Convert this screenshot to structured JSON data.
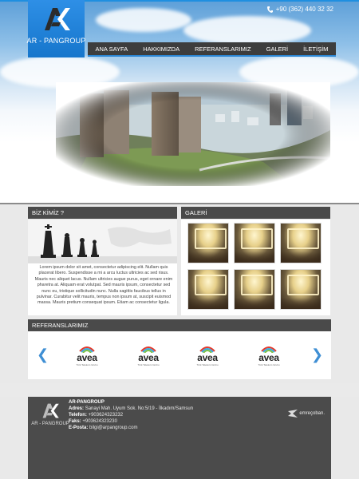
{
  "header": {
    "logo_text": "AR - PANGROUP",
    "phone": "+90 (362) 440 32 32",
    "nav": [
      {
        "label": "ANA SAYFA"
      },
      {
        "label": "HAKKIMIZDA"
      },
      {
        "label": "REFERANSLARIMIZ"
      },
      {
        "label": "GALERİ"
      },
      {
        "label": "İLETİŞİM"
      }
    ],
    "accent_color": "#1f8fe0"
  },
  "about": {
    "title": "BİZ KİMİZ ?",
    "text": "Lorem ipsum dolor sit amet, consectetur adipiscing elit. Nullam quis placerat libero. Suspendisse a mi a arcu luctus ultricies ac sed risus. Mauris nec aliquet lacus. Nullam ultricies augue purus, eget ornare enim pharetra at. Aliquam erat volutpat. Sed mauris ipsum, consectetur sed nunc eu, tristique sollicitudin nunc. Nulla sagittis faucibus tellus in pulvinar. Curabitur velit mauris, tempus non ipsum at, suscipit euismod massa. Mauris pretium consequat ipsum. Etiam ac consectetur ligula."
  },
  "gallery": {
    "title": "GALERİ"
  },
  "references": {
    "title": "REFERANSLARIMIZ",
    "brands": [
      {
        "name": "avea",
        "tagline": "Türk Telekom Grubu"
      },
      {
        "name": "avea",
        "tagline": "Türk Telekom Grubu"
      },
      {
        "name": "avea",
        "tagline": "Türk Telekom Grubu"
      },
      {
        "name": "avea",
        "tagline": "Türk Telekom Grubu"
      }
    ]
  },
  "footer": {
    "logo_text": "AR - PANGROUP",
    "company": "AR-PANGROUP",
    "address_label": "Adres:",
    "address": "Sanayi Mah. Uyum Sok. No:5/19 - İlkadım/Samsun",
    "phone_label": "Telefon:",
    "phone": "+903624323232",
    "fax_label": "Faks:",
    "fax": "+903624323230",
    "email_label": "E-Posta:",
    "email": "bilgi@arpangroup.com",
    "credit": "emreçoban."
  }
}
